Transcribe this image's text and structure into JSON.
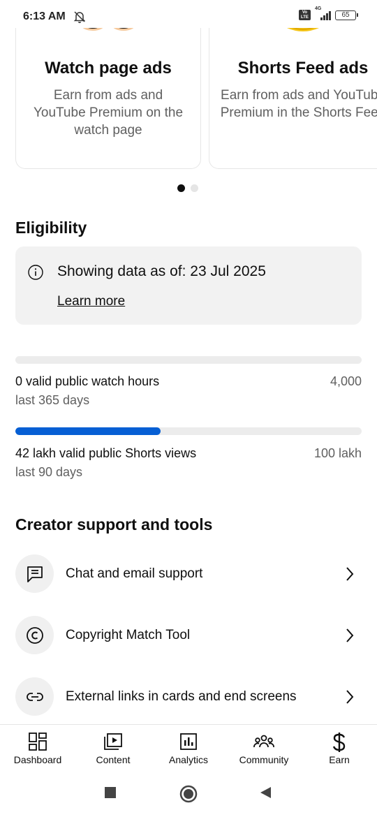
{
  "status_bar": {
    "time": "6:13 AM",
    "network": "4G",
    "battery": "65"
  },
  "cards": [
    {
      "title": "Watch page ads",
      "description": "Earn from ads and YouTube Premium on the watch page"
    },
    {
      "title": "Shorts Feed ads",
      "description": "Earn from ads and YouTube Premium in the Shorts Feed"
    }
  ],
  "carousel": {
    "page": 1,
    "total": 2
  },
  "eligibility": {
    "title": "Eligibility",
    "info_text": "Showing data as of: 23 Jul 2025",
    "learn_more": "Learn more",
    "metrics": [
      {
        "label": "0 valid public watch hours",
        "sub": "last 365 days",
        "target": "4,000",
        "progress": 0.0
      },
      {
        "label": "42 lakh valid public Shorts views",
        "sub": "last 90 days",
        "target": "100 lakh",
        "progress": 0.42
      }
    ]
  },
  "tools": {
    "title": "Creator support and tools",
    "items": [
      {
        "label": "Chat and email support",
        "icon": "chat-icon"
      },
      {
        "label": "Copyright Match Tool",
        "icon": "copyright-icon"
      },
      {
        "label": "External links in cards and end screens",
        "icon": "link-icon"
      }
    ]
  },
  "bottom_nav": [
    {
      "label": "Dashboard",
      "icon": "dashboard-icon"
    },
    {
      "label": "Content",
      "icon": "content-icon"
    },
    {
      "label": "Analytics",
      "icon": "analytics-icon"
    },
    {
      "label": "Community",
      "icon": "community-icon"
    },
    {
      "label": "Earn",
      "icon": "earn-icon"
    }
  ],
  "colors": {
    "accent": "#065fd4",
    "text_primary": "#0f0f0f",
    "text_secondary": "#606060"
  }
}
